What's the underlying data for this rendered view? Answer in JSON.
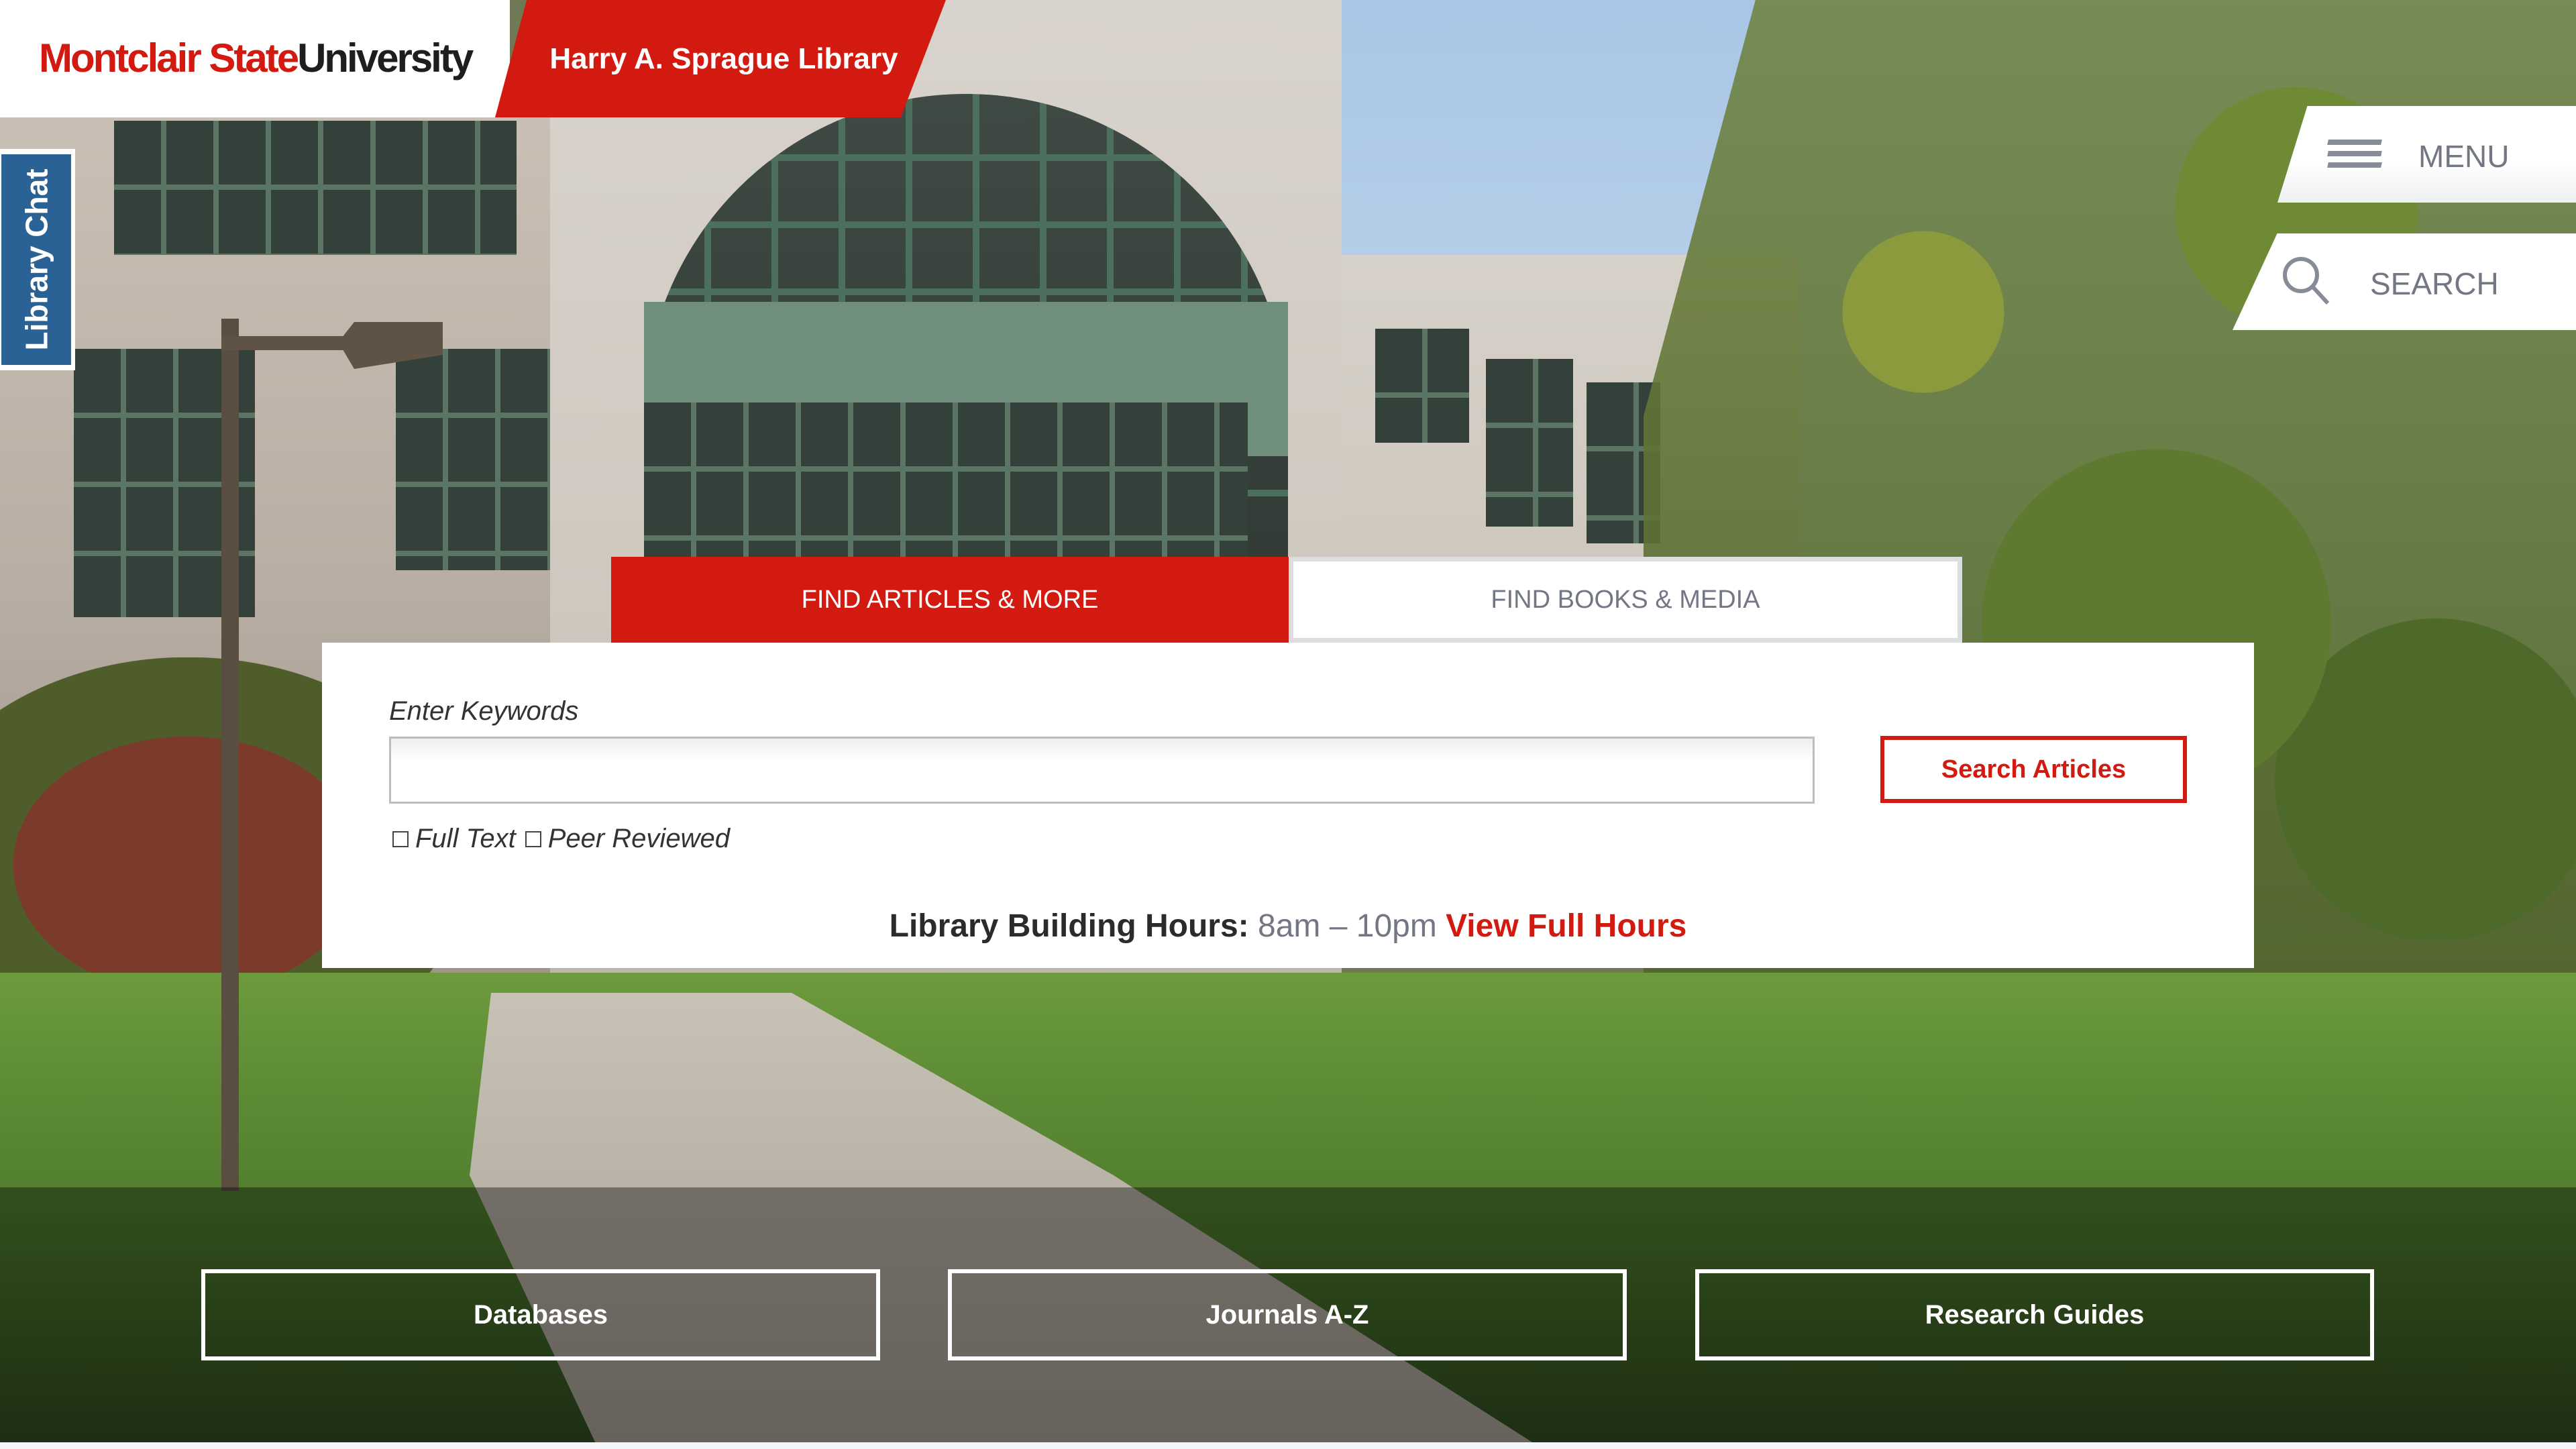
{
  "header": {
    "university_name_part1": "Montclair State",
    "university_name_part2": "University",
    "library_name": "Harry A. Sprague Library"
  },
  "chat": {
    "label": "Library Chat"
  },
  "nav": {
    "menu_label": "MENU",
    "search_label": "SEARCH",
    "menu_icon": "hamburger-icon",
    "search_icon": "magnifier-icon"
  },
  "search": {
    "tabs": [
      {
        "label": "FIND ARTICLES & MORE",
        "active": true
      },
      {
        "label": "FIND BOOKS & MEDIA",
        "active": false
      }
    ],
    "keywords_label": "Enter Keywords",
    "keywords_value": "",
    "keywords_placeholder": "",
    "submit_label": "Search Articles",
    "filters": [
      {
        "label": "Full Text",
        "checked": false
      },
      {
        "label": "Peer Reviewed",
        "checked": false
      }
    ]
  },
  "hours": {
    "label": "Library Building Hours:",
    "time": "8am – 10pm",
    "link": "View Full Hours"
  },
  "quick_links": [
    {
      "label": "Databases"
    },
    {
      "label": "Journals A-Z"
    },
    {
      "label": "Research Guides"
    }
  ],
  "colors": {
    "brand_red": "#d21a10",
    "chat_blue": "#2b6296",
    "nav_gray": "#737784"
  }
}
